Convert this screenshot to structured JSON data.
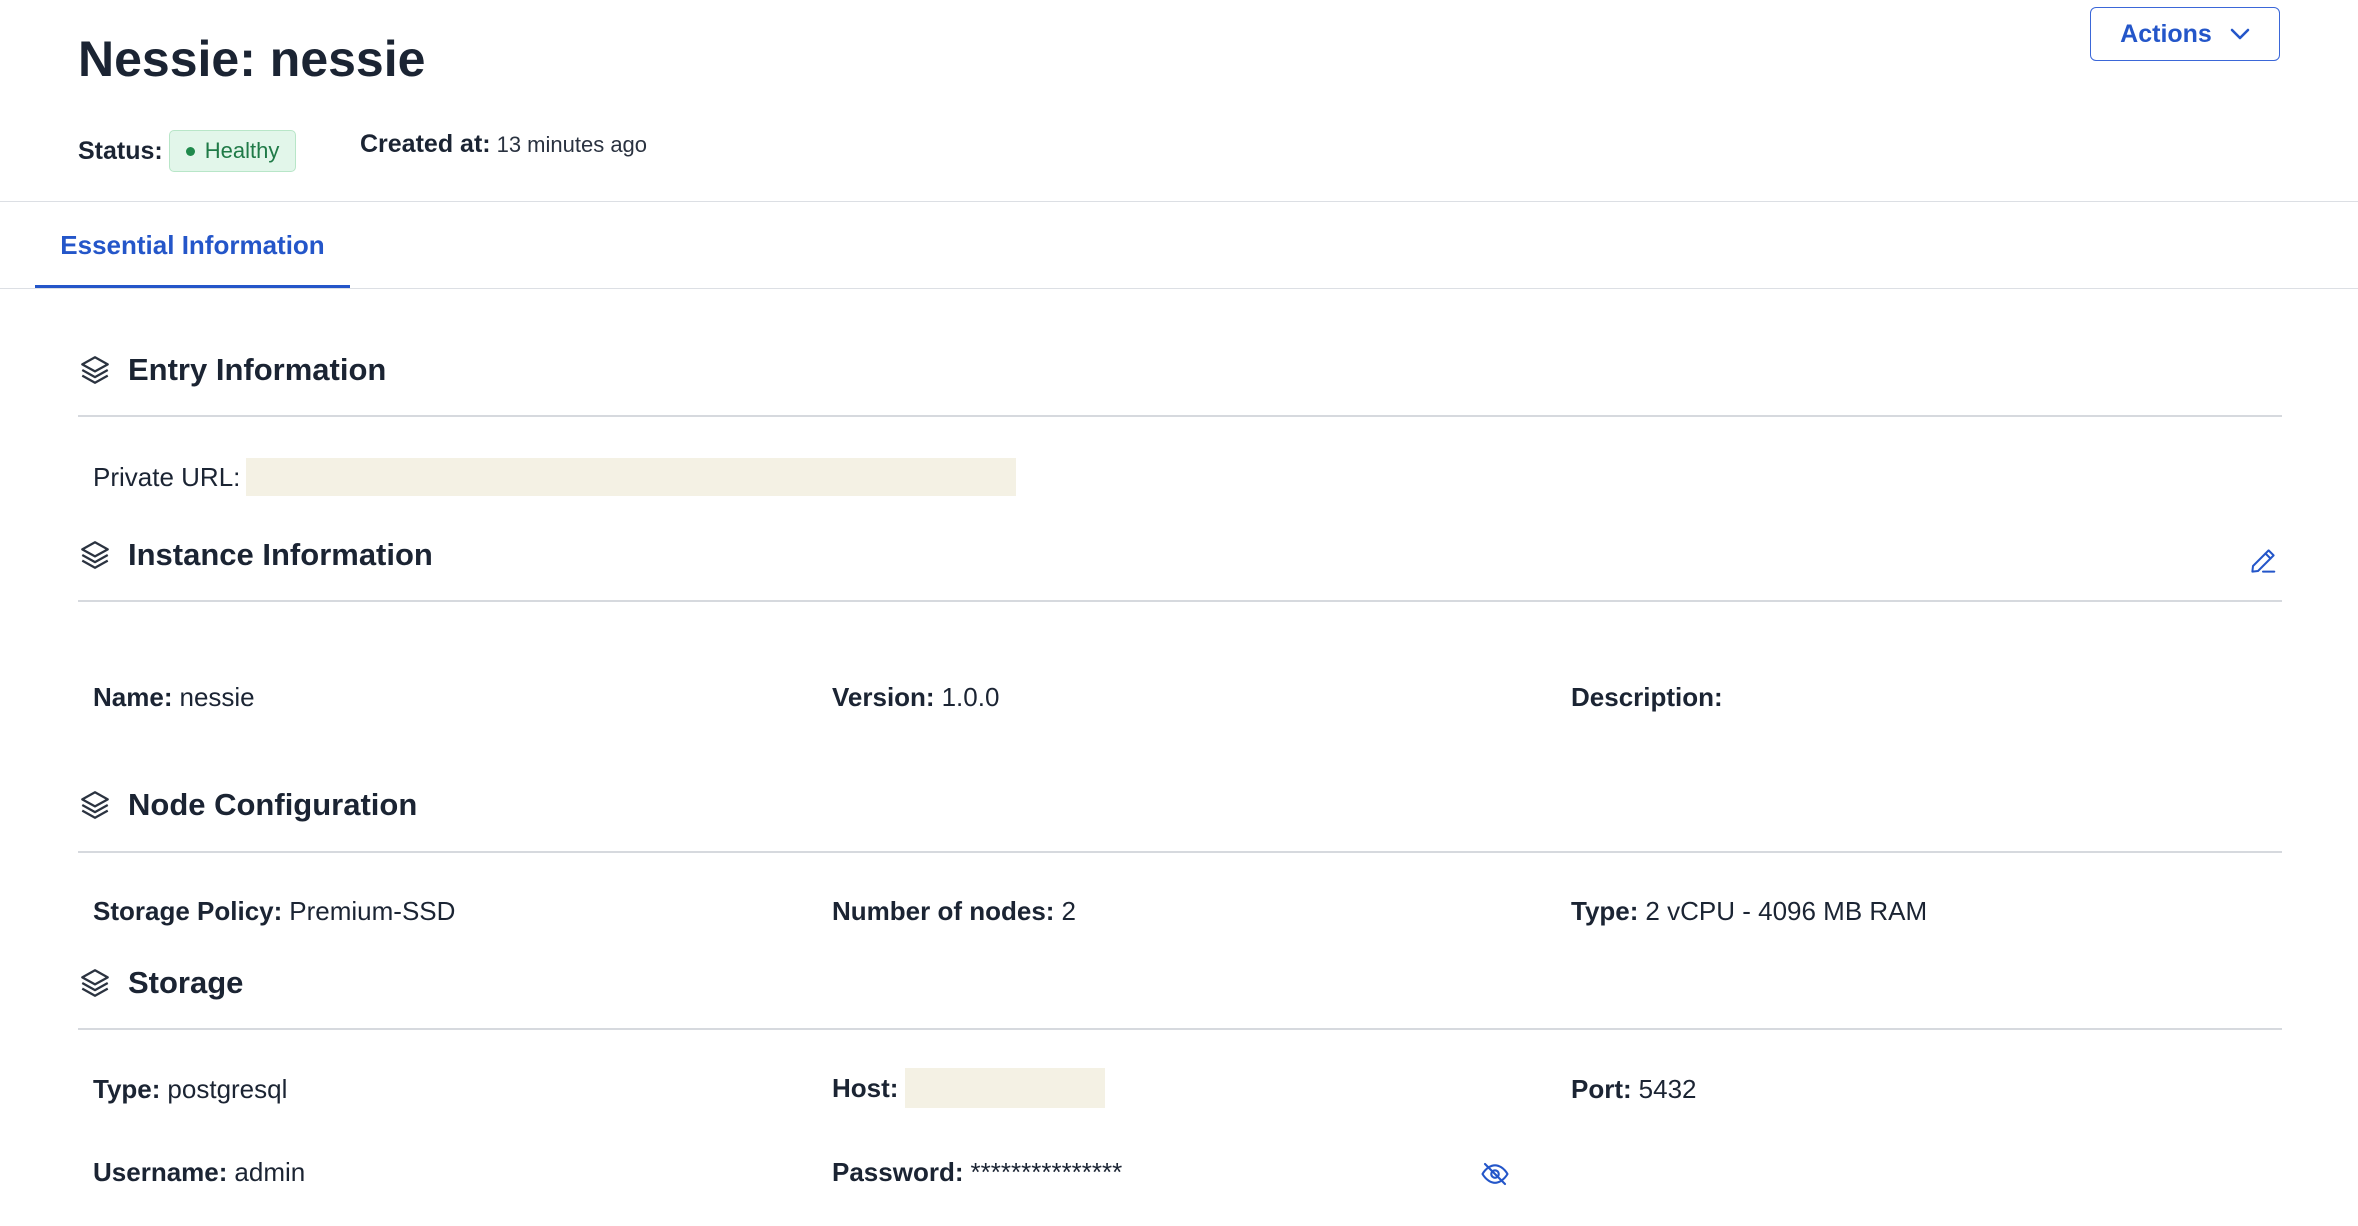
{
  "header": {
    "title": "Nessie: nessie",
    "actions_label": "Actions",
    "status_label": "Status:",
    "status_value": "Healthy",
    "created_label": "Created at:",
    "created_value": "13 minutes ago"
  },
  "tabs": [
    {
      "label": "Essential Information",
      "active": true
    }
  ],
  "sections": {
    "entry": {
      "title": "Entry Information",
      "private_url_label": "Private URL:"
    },
    "instance": {
      "title": "Instance Information",
      "name_label": "Name:",
      "name_value": "nessie",
      "version_label": "Version:",
      "version_value": "1.0.0",
      "description_label": "Description:"
    },
    "node": {
      "title": "Node Configuration",
      "storage_policy_label": "Storage Policy:",
      "storage_policy_value": "Premium-SSD",
      "nodes_label": "Number of nodes:",
      "nodes_value": "2",
      "type_label": "Type:",
      "type_value": "2 vCPU - 4096 MB RAM"
    },
    "storage": {
      "title": "Storage",
      "type_label": "Type:",
      "type_value": "postgresql",
      "host_label": "Host:",
      "port_label": "Port:",
      "port_value": "5432",
      "username_label": "Username:",
      "username_value": "admin",
      "password_label": "Password:",
      "password_value": "***************"
    }
  },
  "icons": {
    "section": "layers-icon",
    "edit": "pencil-icon",
    "reveal": "eye-off-icon",
    "dropdown": "chevron-down-icon"
  },
  "colors": {
    "accent": "#2456c9",
    "healthy_bg": "#e2f6ea",
    "healthy_text": "#1f7a47",
    "redaction": "#f4f1e4"
  }
}
